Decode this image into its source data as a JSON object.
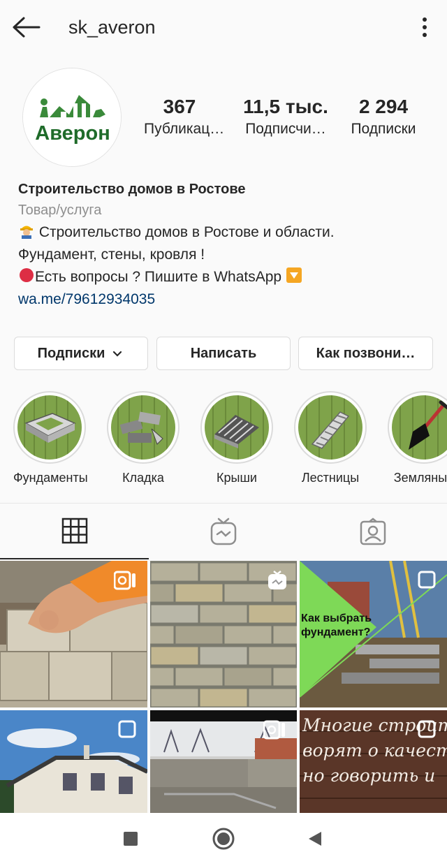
{
  "header": {
    "username": "sk_averon"
  },
  "profile": {
    "avatar_text": "Аверон",
    "stats": [
      {
        "value": "367",
        "label": "Публикац…"
      },
      {
        "value": "11,5 тыс.",
        "label": "Подписчи…"
      },
      {
        "value": "2 294",
        "label": "Подписки"
      }
    ]
  },
  "bio": {
    "name": "Строительство домов в Ростове",
    "category": "Товар/услуга",
    "line1": "Строительство домов в Ростове и области.",
    "line2": "Фундамент, стены, кровля !",
    "line3": "Есть вопросы ? Пишите в WhatsApp",
    "link": "wa.me/79612934035"
  },
  "buttons": {
    "following": "Подписки",
    "message": "Написать",
    "call": "Как позвони…"
  },
  "highlights": [
    {
      "label": "Фундаменты",
      "icon": "foundation-icon"
    },
    {
      "label": "Кладка",
      "icon": "bricks-icon"
    },
    {
      "label": "Крыши",
      "icon": "roof-icon"
    },
    {
      "label": "Лестницы",
      "icon": "stairs-icon"
    },
    {
      "label": "Земляные",
      "icon": "shovel-icon"
    }
  ],
  "tabs": [
    {
      "name": "grid",
      "icon": "grid-icon"
    },
    {
      "name": "igtv",
      "icon": "igtv-icon"
    },
    {
      "name": "tagged",
      "icon": "tagged-icon"
    }
  ],
  "posts": {
    "post3_text": "Как выбрать фундамент?",
    "post6_text1": "Многие строит",
    "post6_text2": "ворят о качеств",
    "post6_text3": "но говорить и"
  },
  "colors": {
    "link": "#00376b",
    "muted": "#8e8e8e",
    "brand_green": "#3a8a3a"
  }
}
